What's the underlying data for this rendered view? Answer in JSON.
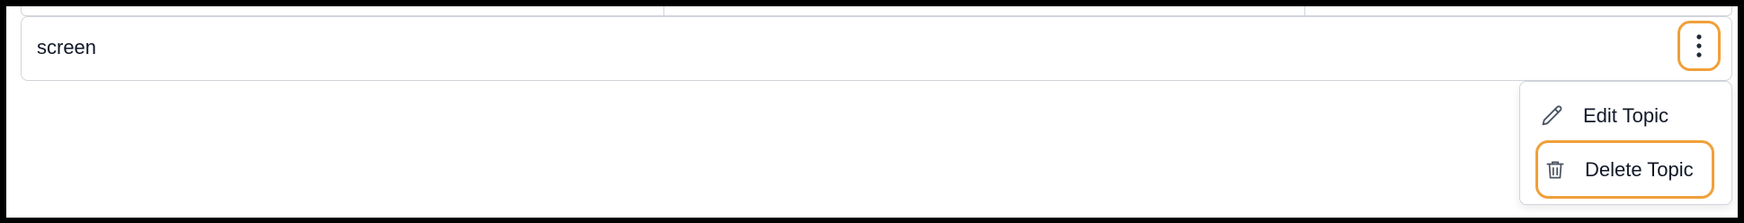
{
  "table": {
    "row": {
      "topic_name": "screen",
      "actions_button": "more-actions"
    }
  },
  "menu": {
    "items": [
      {
        "label": "Edit Topic",
        "icon": "pencil-icon"
      },
      {
        "label": "Delete Topic",
        "icon": "trash-icon"
      }
    ]
  },
  "colors": {
    "highlight": "#f0a03a",
    "border": "#d1d5db",
    "text": "#111827",
    "icon": "#4b5563"
  }
}
